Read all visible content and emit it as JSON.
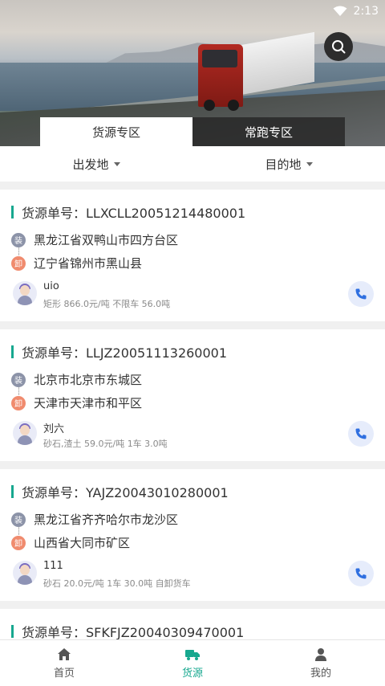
{
  "status": {
    "time": "2:13"
  },
  "tabs": [
    {
      "label": "货源专区",
      "active": true
    },
    {
      "label": "常跑专区",
      "active": false
    }
  ],
  "filters": {
    "origin": "出发地",
    "destination": "目的地"
  },
  "badges": {
    "load": "装",
    "unload": "卸"
  },
  "orders": [
    {
      "title": "货源单号：LLXCLL20051214480001",
      "from": "黑龙江省双鸭山市四方台区",
      "to": "辽宁省锦州市黑山县",
      "owner": "uio",
      "cargo": "矩形 866.0元/吨 不限车 56.0吨"
    },
    {
      "title": "货源单号：LLJZ20051113260001",
      "from": "北京市北京市东城区",
      "to": "天津市天津市和平区",
      "owner": "刘六",
      "cargo": "砂石,渣土 59.0元/吨 1车 3.0吨"
    },
    {
      "title": "货源单号：YAJZ20043010280001",
      "from": "黑龙江省齐齐哈尔市龙沙区",
      "to": "山西省大同市矿区",
      "owner": "111",
      "cargo": "砂石 20.0元/吨 1车 30.0吨 自卸货车"
    },
    {
      "title": "货源单号：SFKFJZ20040309470001"
    }
  ],
  "nav": [
    {
      "label": "首页",
      "icon": "home-icon",
      "active": false
    },
    {
      "label": "货源",
      "icon": "truck-icon",
      "active": true
    },
    {
      "label": "我的",
      "icon": "person-icon",
      "active": false
    }
  ],
  "colors": {
    "accent": "#17a88f",
    "load_badge": "#8c93a8",
    "unload_badge": "#f08b6e",
    "phone": "#2f6fe0"
  }
}
